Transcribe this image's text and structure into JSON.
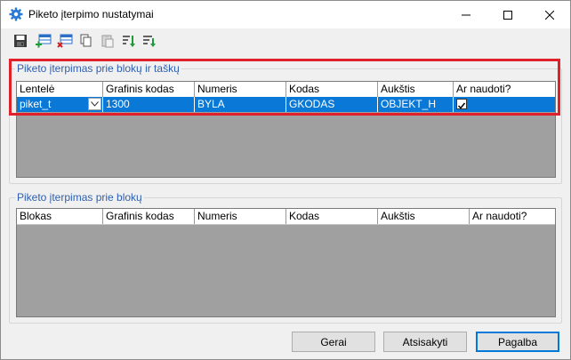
{
  "window": {
    "title": "Piketo įterpimo nustatymai"
  },
  "toolbar": {
    "buttons": [
      {
        "name": "save-icon"
      },
      {
        "name": "add-row-icon"
      },
      {
        "name": "delete-row-icon"
      },
      {
        "name": "copy-icon"
      },
      {
        "name": "paste-icon"
      },
      {
        "name": "sort-icon"
      },
      {
        "name": "filter-icon"
      }
    ]
  },
  "group1": {
    "label": "Piketo įterpimas prie blokų ir taškų",
    "columns": [
      "Lentelė",
      "Grafinis kodas",
      "Numeris",
      "Kodas",
      "Aukštis",
      "Ar naudoti?"
    ],
    "rows": [
      {
        "lentele": "piket_t",
        "grafinis_kodas": "1300",
        "numeris": "BYLA",
        "kodas": "GKODAS",
        "aukstis": "OBJEKT_H",
        "ar_naudoti": true
      }
    ]
  },
  "group2": {
    "label": "Piketo įterpimas prie blokų",
    "columns": [
      "Blokas",
      "Grafinis kodas",
      "Numeris",
      "Kodas",
      "Aukštis",
      "Ar naudoti?"
    ]
  },
  "buttons": {
    "ok": "Gerai",
    "cancel": "Atsisakyti",
    "help": "Pagalba"
  },
  "colors": {
    "selection": "#0a78d7",
    "highlight_border": "#e0202a",
    "group_label": "#2e5fb0",
    "grid_background": "#a0a0a0"
  }
}
